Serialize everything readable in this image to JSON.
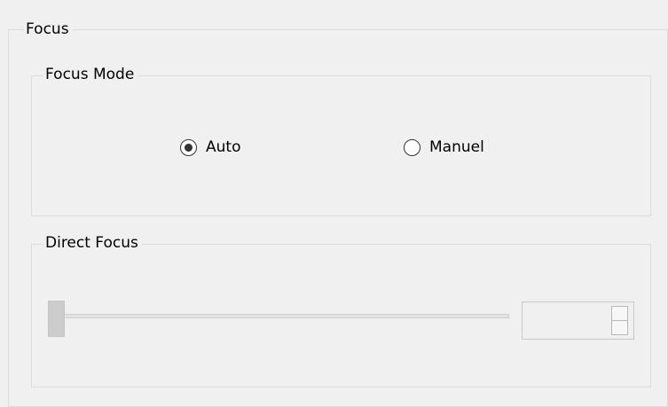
{
  "groups": {
    "outer_title": "Focus",
    "mode_title": "Focus Mode",
    "direct_title": "Direct Focus"
  },
  "focus_mode": {
    "options": [
      {
        "label": "Auto",
        "selected": true
      },
      {
        "label": "Manuel",
        "selected": false
      }
    ]
  },
  "direct_focus": {
    "slider_value_fraction": 0,
    "enabled": false,
    "spin_value": ""
  },
  "icons": {
    "spin_up": "spin-up-icon",
    "spin_down": "spin-down-icon"
  },
  "colors": {
    "background": "#f0f0f0",
    "groupbox_border": "#dcdcdc",
    "radio_dot": "#333333",
    "disabled_thumb": "#cccccc"
  }
}
